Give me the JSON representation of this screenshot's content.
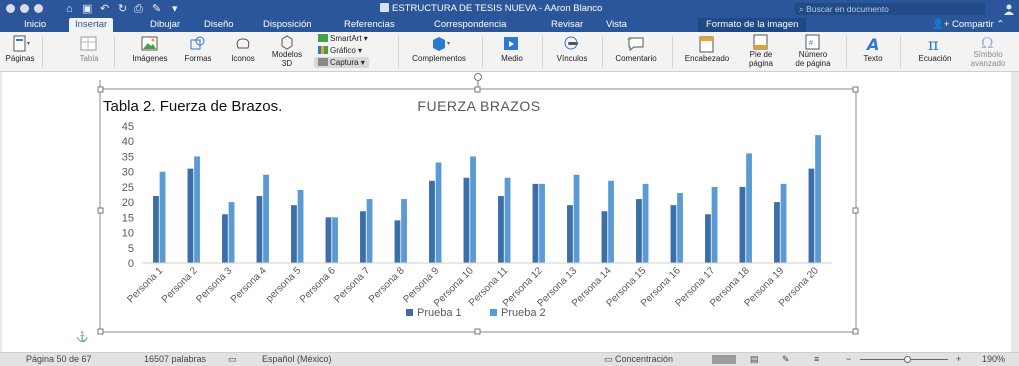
{
  "window": {
    "title": "ESTRUCTURA DE TESIS NUEVA  -  AAron Blanco",
    "search_placeholder": "Buscar en documento"
  },
  "tabs": [
    {
      "label": "Inicio"
    },
    {
      "label": "Insertar"
    },
    {
      "label": "Dibujar"
    },
    {
      "label": "Diseño"
    },
    {
      "label": "Disposición"
    },
    {
      "label": "Referencias"
    },
    {
      "label": "Correspondencia"
    },
    {
      "label": "Revisar"
    },
    {
      "label": "Vista"
    },
    {
      "label": "Formato de la imagen"
    }
  ],
  "share_label": "Compartir",
  "ribbon": {
    "paginas": "Páginas",
    "tabla": "Tabla",
    "imagenes": "Imágenes",
    "formas": "Formas",
    "iconos": "Iconos",
    "modelos_1": "Modelos",
    "modelos_2": "3D",
    "smartart": "SmartArt",
    "grafico": "Gráfico",
    "captura": "Captura",
    "complementos": "Complementos",
    "medio": "Medio",
    "vinculos": "Vínculos",
    "comentario": "Comentario",
    "encabezado": "Encabezado",
    "pie_1": "Pie de",
    "pie_2": "página",
    "numero_1": "Número",
    "numero_2": "de página",
    "texto": "Texto",
    "ecuacion": "Ecuación",
    "simbolo_1": "Símbolo",
    "simbolo_2": "avanzado"
  },
  "document": {
    "caption": "Tabla 2. Fuerza de Brazos."
  },
  "chart_data": {
    "type": "bar",
    "title": "FUERZA BRAZOS",
    "categories": [
      "Persona 1",
      "Persona 2",
      "Persona 3",
      "Persona 4",
      "persona 5",
      "Persona 6",
      "Persona 7",
      "Persona 8",
      "Persona 9",
      "Persona 10",
      "Persona 11",
      "Persona 12",
      "Persona 13",
      "Persona 14",
      "Persona 15",
      "Persona 16",
      "Persona 17",
      "Persona 18",
      "Persona 19",
      "Persona 20"
    ],
    "series": [
      {
        "name": "Prueba 1",
        "color": "#3c6ea8",
        "values": [
          22,
          31,
          16,
          22,
          19,
          15,
          17,
          14,
          27,
          28,
          22,
          26,
          19,
          17,
          21,
          19,
          16,
          25,
          20,
          31
        ]
      },
      {
        "name": "Prueba 2",
        "color": "#5b9bd5",
        "values": [
          30,
          35,
          20,
          29,
          24,
          15,
          21,
          21,
          33,
          35,
          28,
          26,
          29,
          27,
          26,
          23,
          25,
          36,
          26,
          42
        ]
      }
    ],
    "ylim": [
      0,
      45
    ],
    "yticks": [
      "0",
      "5",
      "10",
      "15",
      "20",
      "25",
      "30",
      "35",
      "40",
      "45"
    ],
    "grid": false,
    "legend": "bottom"
  },
  "status": {
    "page": "Página 50 de 67",
    "words": "16507 palabras",
    "language": "Español (México)",
    "focus": "Concentración",
    "zoom": "190%"
  }
}
